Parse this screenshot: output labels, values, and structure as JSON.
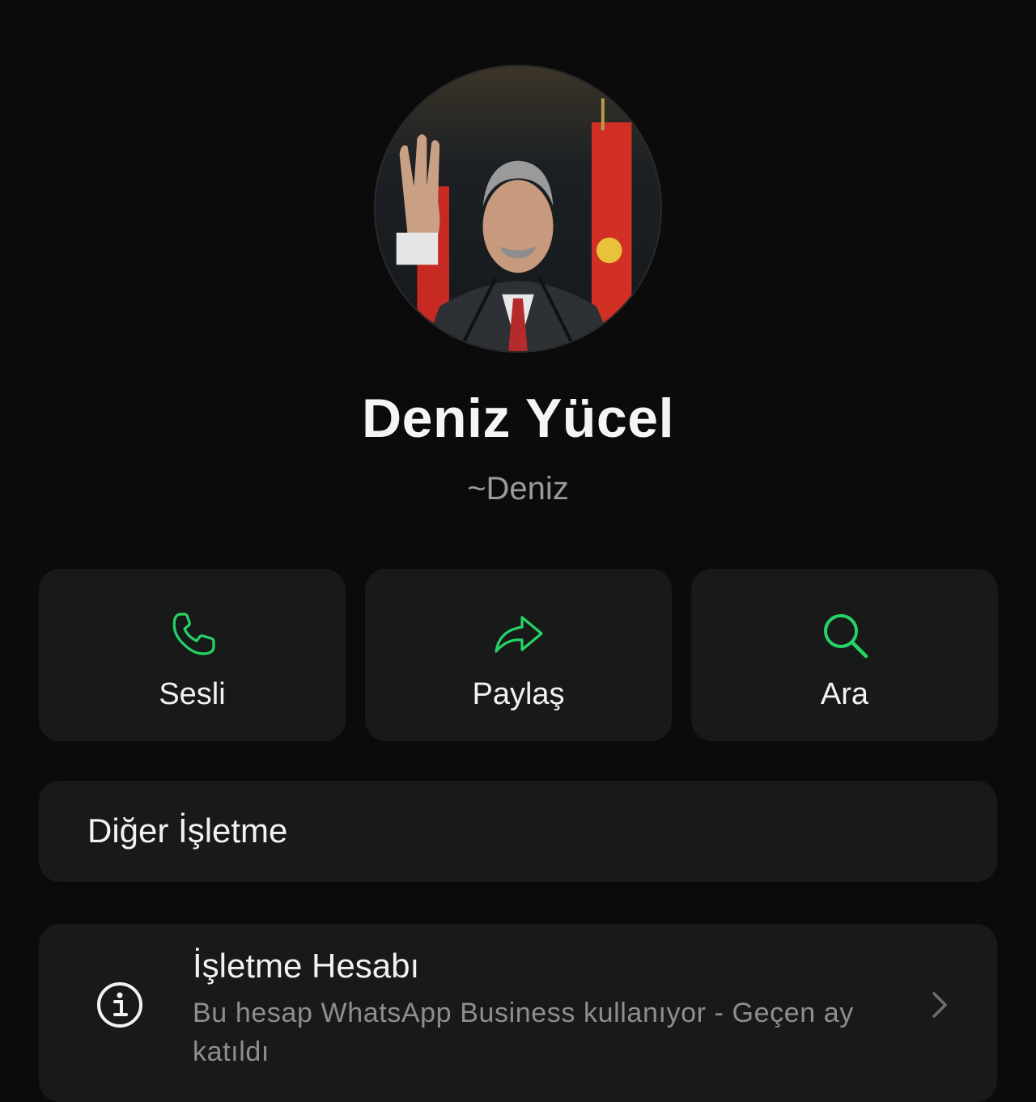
{
  "profile": {
    "name": "Deniz Yücel",
    "handle": "~Deniz"
  },
  "actions": [
    {
      "label": "Sesli",
      "icon": "phone-icon"
    },
    {
      "label": "Paylaş",
      "icon": "share-arrow-icon"
    },
    {
      "label": "Ara",
      "icon": "search-icon"
    }
  ],
  "other_business": {
    "label": "Diğer İşletme"
  },
  "business_account": {
    "icon": "info-icon",
    "title": "İşletme Hesabı",
    "description": "Bu hesap WhatsApp Business kullanıyor - Geçen ay katıldı"
  },
  "colors": {
    "background": "#0b0b0b",
    "card": "#181a1a",
    "accent": "#25d366",
    "text": "#f2f2f2",
    "muted": "#9a9a9a"
  }
}
